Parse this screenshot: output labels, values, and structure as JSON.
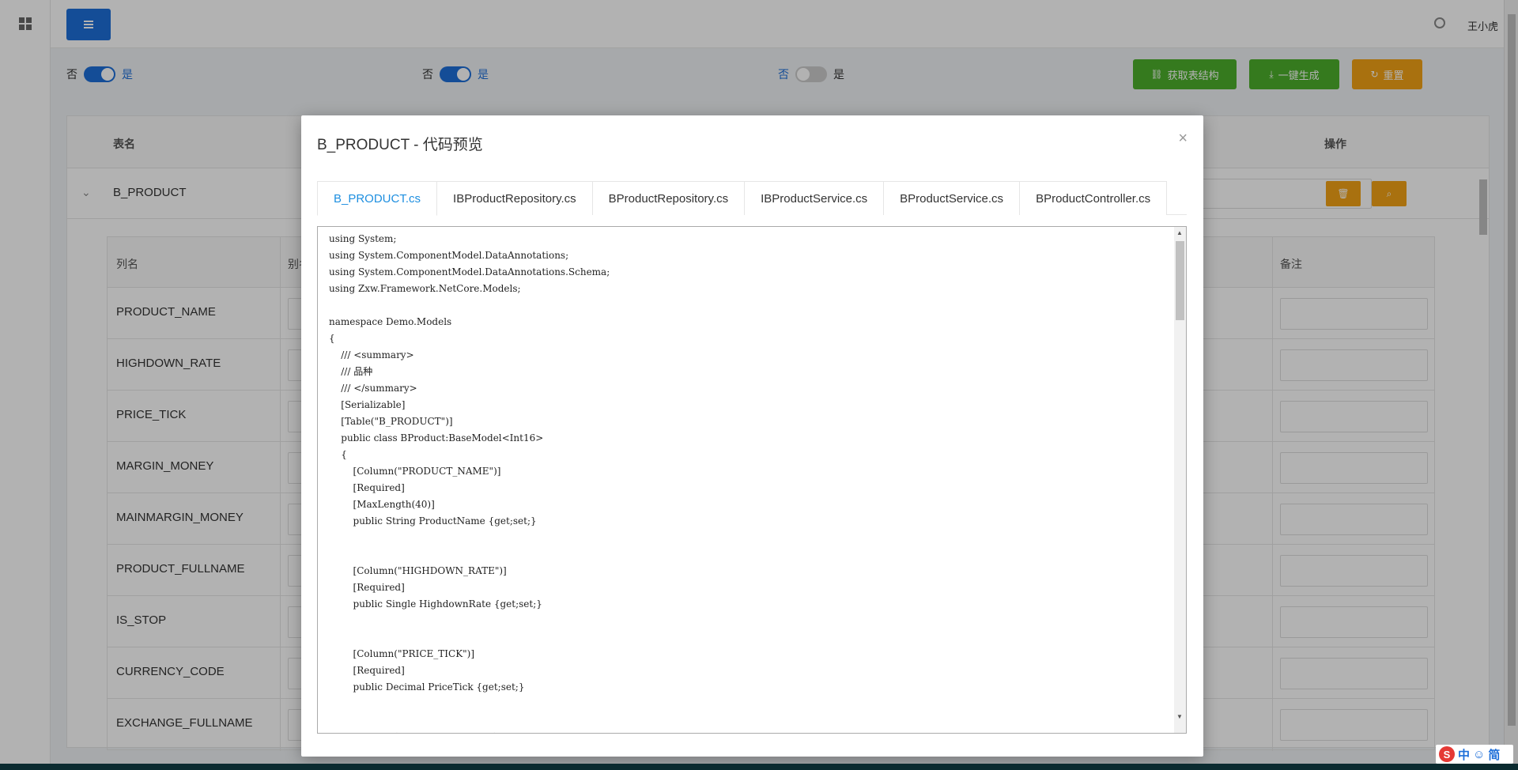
{
  "header": {
    "user_name": "王小虎"
  },
  "toolbar": {
    "toggles": [
      {
        "off_label": "否",
        "on_label": "是",
        "state": "on"
      },
      {
        "off_label": "否",
        "on_label": "是",
        "state": "on"
      },
      {
        "off_label": "否",
        "on_label": "是",
        "state": "off"
      }
    ],
    "get_structure_label": "获取表结构",
    "generate_label": "一键生成",
    "reset_label": "重置"
  },
  "table": {
    "col_table_name": "表名",
    "col_actions": "操作",
    "row_name": "B_PRODUCT"
  },
  "subtable": {
    "col_column_name": "列名",
    "col_alias": "别名",
    "col_remark": "备注",
    "rows": [
      "PRODUCT_NAME",
      "HIGHDOWN_RATE",
      "PRICE_TICK",
      "MARGIN_MONEY",
      "MAINMARGIN_MONEY",
      "PRODUCT_FULLNAME",
      "IS_STOP",
      "CURRENCY_CODE",
      "EXCHANGE_FULLNAME"
    ]
  },
  "modal": {
    "title": "B_PRODUCT - 代码预览",
    "close_glyph": "×",
    "tabs": [
      "B_PRODUCT.cs",
      "IBProductRepository.cs",
      "BProductRepository.cs",
      "IBProductService.cs",
      "BProductService.cs",
      "BProductController.cs"
    ],
    "active_tab": 0,
    "code": "using System;\nusing System.ComponentModel.DataAnnotations;\nusing System.ComponentModel.DataAnnotations.Schema;\nusing Zxw.Framework.NetCore.Models;\n\nnamespace Demo.Models\n{\n\t/// <summary>\n\t/// 品种\n\t/// </summary>\n\t[Serializable]\n\t[Table(\"B_PRODUCT\")]\n\tpublic class BProduct:BaseModel<Int16>\n\t{\n\t\t[Column(\"PRODUCT_NAME\")]\n\t\t[Required]\n\t\t[MaxLength(40)]\n\t\tpublic String ProductName {get;set;}\n\n\n\t\t[Column(\"HIGHDOWN_RATE\")]\n\t\t[Required]\n\t\tpublic Single HighdownRate {get;set;}\n\n\n\t\t[Column(\"PRICE_TICK\")]\n\t\t[Required]\n\t\tpublic Decimal PriceTick {get;set;}\n\n\n\t\t[Column(\"MARGIN_MONEY\")]"
  },
  "ime": {
    "logo": "S",
    "mode": "中",
    "emoji": "☺",
    "charset": "简"
  },
  "colors": {
    "primary": "#1e6fd9",
    "green": "#4caf2c",
    "orange": "#f2a316",
    "tab_active": "#1e8fe0"
  }
}
